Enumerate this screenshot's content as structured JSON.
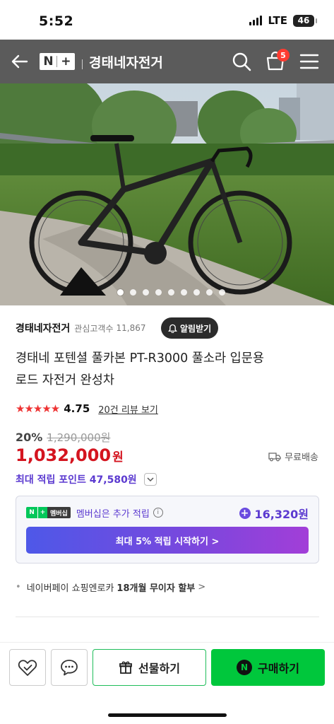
{
  "status_bar": {
    "time": "5:52",
    "network": "LTE",
    "battery": "46"
  },
  "header": {
    "logo_n": "N",
    "logo_plus": "+",
    "title": "경태네자전거",
    "cart_count": "5"
  },
  "hero": {
    "total_slides": 9,
    "active_index": 0
  },
  "store": {
    "name": "경태네자전거",
    "followers_label": "관심고객수",
    "followers_count": "11,867",
    "alarm_label": "알림받기"
  },
  "product": {
    "title_line1": "경태네 포텐셜 풀카본 PT-R3000 풀소라 입문용",
    "title_line2": "로드 자전거 완성차",
    "stars": "★★★★★",
    "rating": "4.75",
    "review_link": "20건 리뷰 보기",
    "discount": "20%",
    "original_price": "1,290,000원",
    "price": "1,032,000",
    "currency": "원",
    "shipping": "무료배송",
    "max_points": "최대 적립 포인트 47,580원"
  },
  "membership": {
    "badge_n": "N",
    "badge_plus": "+",
    "badge_text": "멤버십",
    "text": "멤버십은 추가 적립",
    "info": "i",
    "points": "16,320원",
    "cta": "최대 5% 적립 시작하기 >"
  },
  "installment": {
    "bullet": "•",
    "text": "네이버페이 쇼핑엔로카",
    "bold": "18개월 무이자 할부",
    "chevron": ">"
  },
  "bottom_bar": {
    "gift_label": "선물하기",
    "buy_label": "구매하기",
    "buy_n": "N"
  },
  "colors": {
    "brand_green": "#00c73c",
    "price_red": "#d4141f",
    "point_purple": "#5b3ad0"
  }
}
